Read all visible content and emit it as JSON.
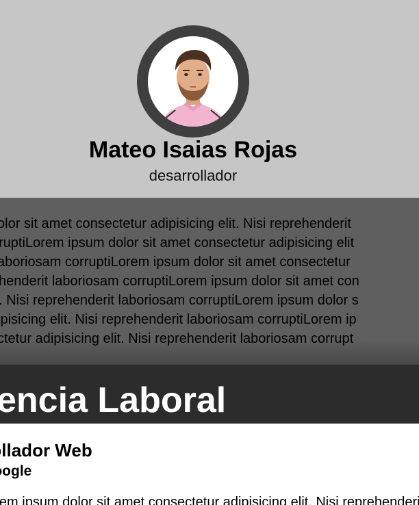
{
  "profile": {
    "name": "Mateo Isaias Rojas",
    "role": "desarrollador",
    "avatar": "profile-photo"
  },
  "about": {
    "lines": [
      "olor sit amet consectetur adipisicing elit. Nisi reprehenderit",
      "ruptiLorem ipsum dolor sit amet consectetur adipisicing elit",
      "aboriosam corruptiLorem ipsum dolor sit amet consectetur",
      "henderit laboriosam corruptiLorem ipsum dolor sit amet con",
      ". Nisi reprehenderit laboriosam corruptiLorem ipsum dolor s",
      "ipisicing elit. Nisi reprehenderit laboriosam corruptiLorem ip",
      "ctetur adipisicing elit. Nisi reprehenderit laboriosam corrupt"
    ]
  },
  "experience": {
    "section_title": "Experiencia Laboral",
    "job_title": "Desarrollador Web",
    "company": "Google",
    "description": "Lorem ipsum dolor sit amet consectetur adipisicing elit. Nisi reprehenderit"
  },
  "colors": {
    "header_bg": "#c6c6c6",
    "avatar_ring": "#3f3f3f",
    "about_bg": "#5f5f5f",
    "section_bar": "#2c2c2c"
  }
}
